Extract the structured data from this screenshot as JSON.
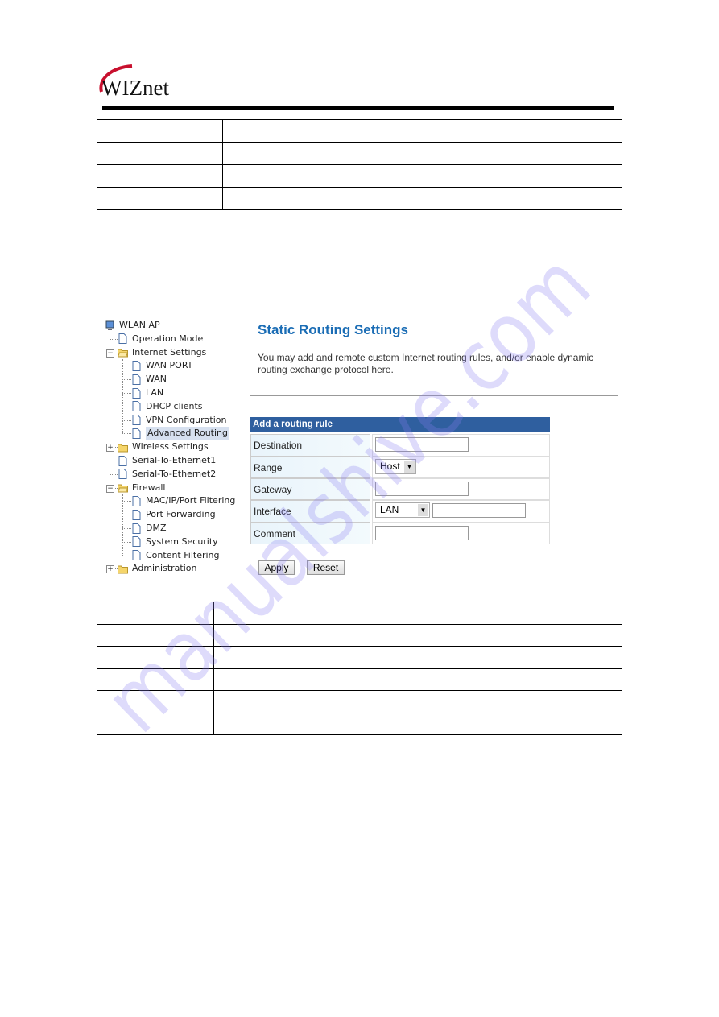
{
  "header": {
    "logo_text": "WIZnet",
    "brand_color": "#c8102e"
  },
  "top_table": {
    "rows": [
      [
        "",
        ""
      ],
      [
        "",
        ""
      ],
      [
        "",
        ""
      ],
      [
        "",
        ""
      ]
    ]
  },
  "tree": {
    "items": [
      {
        "label": "WLAN AP",
        "icon": "computer-icon",
        "depth": 0
      },
      {
        "label": "Operation Mode",
        "icon": "page-icon",
        "depth": 1
      },
      {
        "label": "Internet Settings",
        "icon": "folder-open-icon",
        "depth": 1,
        "expander": "minus"
      },
      {
        "label": "WAN PORT",
        "icon": "page-icon",
        "depth": 2
      },
      {
        "label": "WAN",
        "icon": "page-icon",
        "depth": 2
      },
      {
        "label": "LAN",
        "icon": "page-icon",
        "depth": 2
      },
      {
        "label": "DHCP clients",
        "icon": "page-icon",
        "depth": 2
      },
      {
        "label": "VPN Configuration",
        "icon": "page-icon",
        "depth": 2
      },
      {
        "label": "Advanced Routing",
        "icon": "page-icon",
        "depth": 2,
        "selected": true
      },
      {
        "label": "Wireless Settings",
        "icon": "folder-icon",
        "depth": 1,
        "expander": "plus"
      },
      {
        "label": "Serial-To-Ethernet1",
        "icon": "page-icon",
        "depth": 1
      },
      {
        "label": "Serial-To-Ethernet2",
        "icon": "page-icon",
        "depth": 1
      },
      {
        "label": "Firewall",
        "icon": "folder-open-icon",
        "depth": 1,
        "expander": "minus"
      },
      {
        "label": "MAC/IP/Port Filtering",
        "icon": "page-icon",
        "depth": 2
      },
      {
        "label": "Port Forwarding",
        "icon": "page-icon",
        "depth": 2
      },
      {
        "label": "DMZ",
        "icon": "page-icon",
        "depth": 2
      },
      {
        "label": "System Security",
        "icon": "page-icon",
        "depth": 2
      },
      {
        "label": "Content Filtering",
        "icon": "page-icon",
        "depth": 2
      },
      {
        "label": "Administration",
        "icon": "folder-icon",
        "depth": 1,
        "expander": "plus"
      }
    ]
  },
  "main": {
    "title": "Static Routing Settings",
    "description": "You may add and remote custom Internet routing rules, and/or enable dynamic routing exchange protocol here.",
    "form": {
      "header": "Add a routing rule",
      "destination_label": "Destination",
      "destination_value": "",
      "range_label": "Range",
      "range_value": "Host",
      "gateway_label": "Gateway",
      "gateway_value": "",
      "interface_label": "Interface",
      "interface_value": "LAN",
      "interface_custom_value": "",
      "comment_label": "Comment",
      "comment_value": ""
    },
    "apply_label": "Apply",
    "reset_label": "Reset",
    "title_color": "#1b6db5",
    "header_color": "#2f5f9f"
  },
  "bottom_table": {
    "rows": [
      [
        "",
        ""
      ],
      [
        "",
        ""
      ],
      [
        "",
        ""
      ],
      [
        "",
        ""
      ],
      [
        "",
        ""
      ],
      [
        "",
        ""
      ]
    ]
  },
  "watermark": "manualshive.com"
}
